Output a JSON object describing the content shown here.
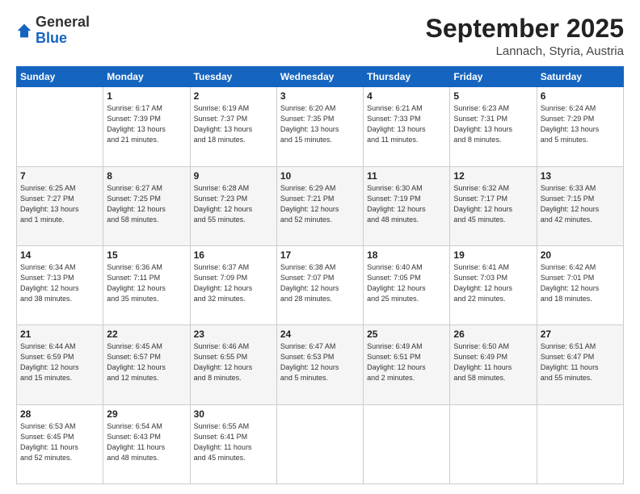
{
  "header": {
    "logo_general": "General",
    "logo_blue": "Blue",
    "month_title": "September 2025",
    "location": "Lannach, Styria, Austria"
  },
  "days_of_week": [
    "Sunday",
    "Monday",
    "Tuesday",
    "Wednesday",
    "Thursday",
    "Friday",
    "Saturday"
  ],
  "weeks": [
    [
      {
        "day": "",
        "text": ""
      },
      {
        "day": "1",
        "text": "Sunrise: 6:17 AM\nSunset: 7:39 PM\nDaylight: 13 hours\nand 21 minutes."
      },
      {
        "day": "2",
        "text": "Sunrise: 6:19 AM\nSunset: 7:37 PM\nDaylight: 13 hours\nand 18 minutes."
      },
      {
        "day": "3",
        "text": "Sunrise: 6:20 AM\nSunset: 7:35 PM\nDaylight: 13 hours\nand 15 minutes."
      },
      {
        "day": "4",
        "text": "Sunrise: 6:21 AM\nSunset: 7:33 PM\nDaylight: 13 hours\nand 11 minutes."
      },
      {
        "day": "5",
        "text": "Sunrise: 6:23 AM\nSunset: 7:31 PM\nDaylight: 13 hours\nand 8 minutes."
      },
      {
        "day": "6",
        "text": "Sunrise: 6:24 AM\nSunset: 7:29 PM\nDaylight: 13 hours\nand 5 minutes."
      }
    ],
    [
      {
        "day": "7",
        "text": "Sunrise: 6:25 AM\nSunset: 7:27 PM\nDaylight: 13 hours\nand 1 minute."
      },
      {
        "day": "8",
        "text": "Sunrise: 6:27 AM\nSunset: 7:25 PM\nDaylight: 12 hours\nand 58 minutes."
      },
      {
        "day": "9",
        "text": "Sunrise: 6:28 AM\nSunset: 7:23 PM\nDaylight: 12 hours\nand 55 minutes."
      },
      {
        "day": "10",
        "text": "Sunrise: 6:29 AM\nSunset: 7:21 PM\nDaylight: 12 hours\nand 52 minutes."
      },
      {
        "day": "11",
        "text": "Sunrise: 6:30 AM\nSunset: 7:19 PM\nDaylight: 12 hours\nand 48 minutes."
      },
      {
        "day": "12",
        "text": "Sunrise: 6:32 AM\nSunset: 7:17 PM\nDaylight: 12 hours\nand 45 minutes."
      },
      {
        "day": "13",
        "text": "Sunrise: 6:33 AM\nSunset: 7:15 PM\nDaylight: 12 hours\nand 42 minutes."
      }
    ],
    [
      {
        "day": "14",
        "text": "Sunrise: 6:34 AM\nSunset: 7:13 PM\nDaylight: 12 hours\nand 38 minutes."
      },
      {
        "day": "15",
        "text": "Sunrise: 6:36 AM\nSunset: 7:11 PM\nDaylight: 12 hours\nand 35 minutes."
      },
      {
        "day": "16",
        "text": "Sunrise: 6:37 AM\nSunset: 7:09 PM\nDaylight: 12 hours\nand 32 minutes."
      },
      {
        "day": "17",
        "text": "Sunrise: 6:38 AM\nSunset: 7:07 PM\nDaylight: 12 hours\nand 28 minutes."
      },
      {
        "day": "18",
        "text": "Sunrise: 6:40 AM\nSunset: 7:05 PM\nDaylight: 12 hours\nand 25 minutes."
      },
      {
        "day": "19",
        "text": "Sunrise: 6:41 AM\nSunset: 7:03 PM\nDaylight: 12 hours\nand 22 minutes."
      },
      {
        "day": "20",
        "text": "Sunrise: 6:42 AM\nSunset: 7:01 PM\nDaylight: 12 hours\nand 18 minutes."
      }
    ],
    [
      {
        "day": "21",
        "text": "Sunrise: 6:44 AM\nSunset: 6:59 PM\nDaylight: 12 hours\nand 15 minutes."
      },
      {
        "day": "22",
        "text": "Sunrise: 6:45 AM\nSunset: 6:57 PM\nDaylight: 12 hours\nand 12 minutes."
      },
      {
        "day": "23",
        "text": "Sunrise: 6:46 AM\nSunset: 6:55 PM\nDaylight: 12 hours\nand 8 minutes."
      },
      {
        "day": "24",
        "text": "Sunrise: 6:47 AM\nSunset: 6:53 PM\nDaylight: 12 hours\nand 5 minutes."
      },
      {
        "day": "25",
        "text": "Sunrise: 6:49 AM\nSunset: 6:51 PM\nDaylight: 12 hours\nand 2 minutes."
      },
      {
        "day": "26",
        "text": "Sunrise: 6:50 AM\nSunset: 6:49 PM\nDaylight: 11 hours\nand 58 minutes."
      },
      {
        "day": "27",
        "text": "Sunrise: 6:51 AM\nSunset: 6:47 PM\nDaylight: 11 hours\nand 55 minutes."
      }
    ],
    [
      {
        "day": "28",
        "text": "Sunrise: 6:53 AM\nSunset: 6:45 PM\nDaylight: 11 hours\nand 52 minutes."
      },
      {
        "day": "29",
        "text": "Sunrise: 6:54 AM\nSunset: 6:43 PM\nDaylight: 11 hours\nand 48 minutes."
      },
      {
        "day": "30",
        "text": "Sunrise: 6:55 AM\nSunset: 6:41 PM\nDaylight: 11 hours\nand 45 minutes."
      },
      {
        "day": "",
        "text": ""
      },
      {
        "day": "",
        "text": ""
      },
      {
        "day": "",
        "text": ""
      },
      {
        "day": "",
        "text": ""
      }
    ]
  ]
}
